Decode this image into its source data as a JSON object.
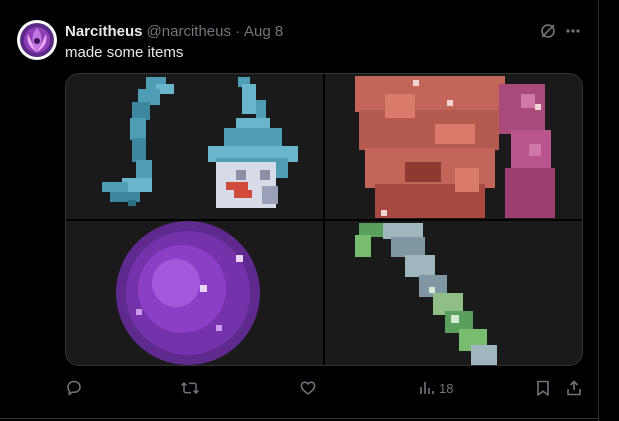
{
  "tweet": {
    "author_name": "Narcitheus",
    "author_handle": "@narcitheus",
    "separator": "·",
    "date": "Aug 8",
    "text": "made some items"
  },
  "media": {
    "images": [
      "armor-items-image",
      "flesh-item-image",
      "purple-orb-image",
      "sword-image"
    ]
  },
  "actions": {
    "views_count": "18"
  },
  "colors": {
    "background": "#000000",
    "text_primary": "#e7e9ea",
    "text_secondary": "#71767b",
    "border": "#2f3336"
  }
}
